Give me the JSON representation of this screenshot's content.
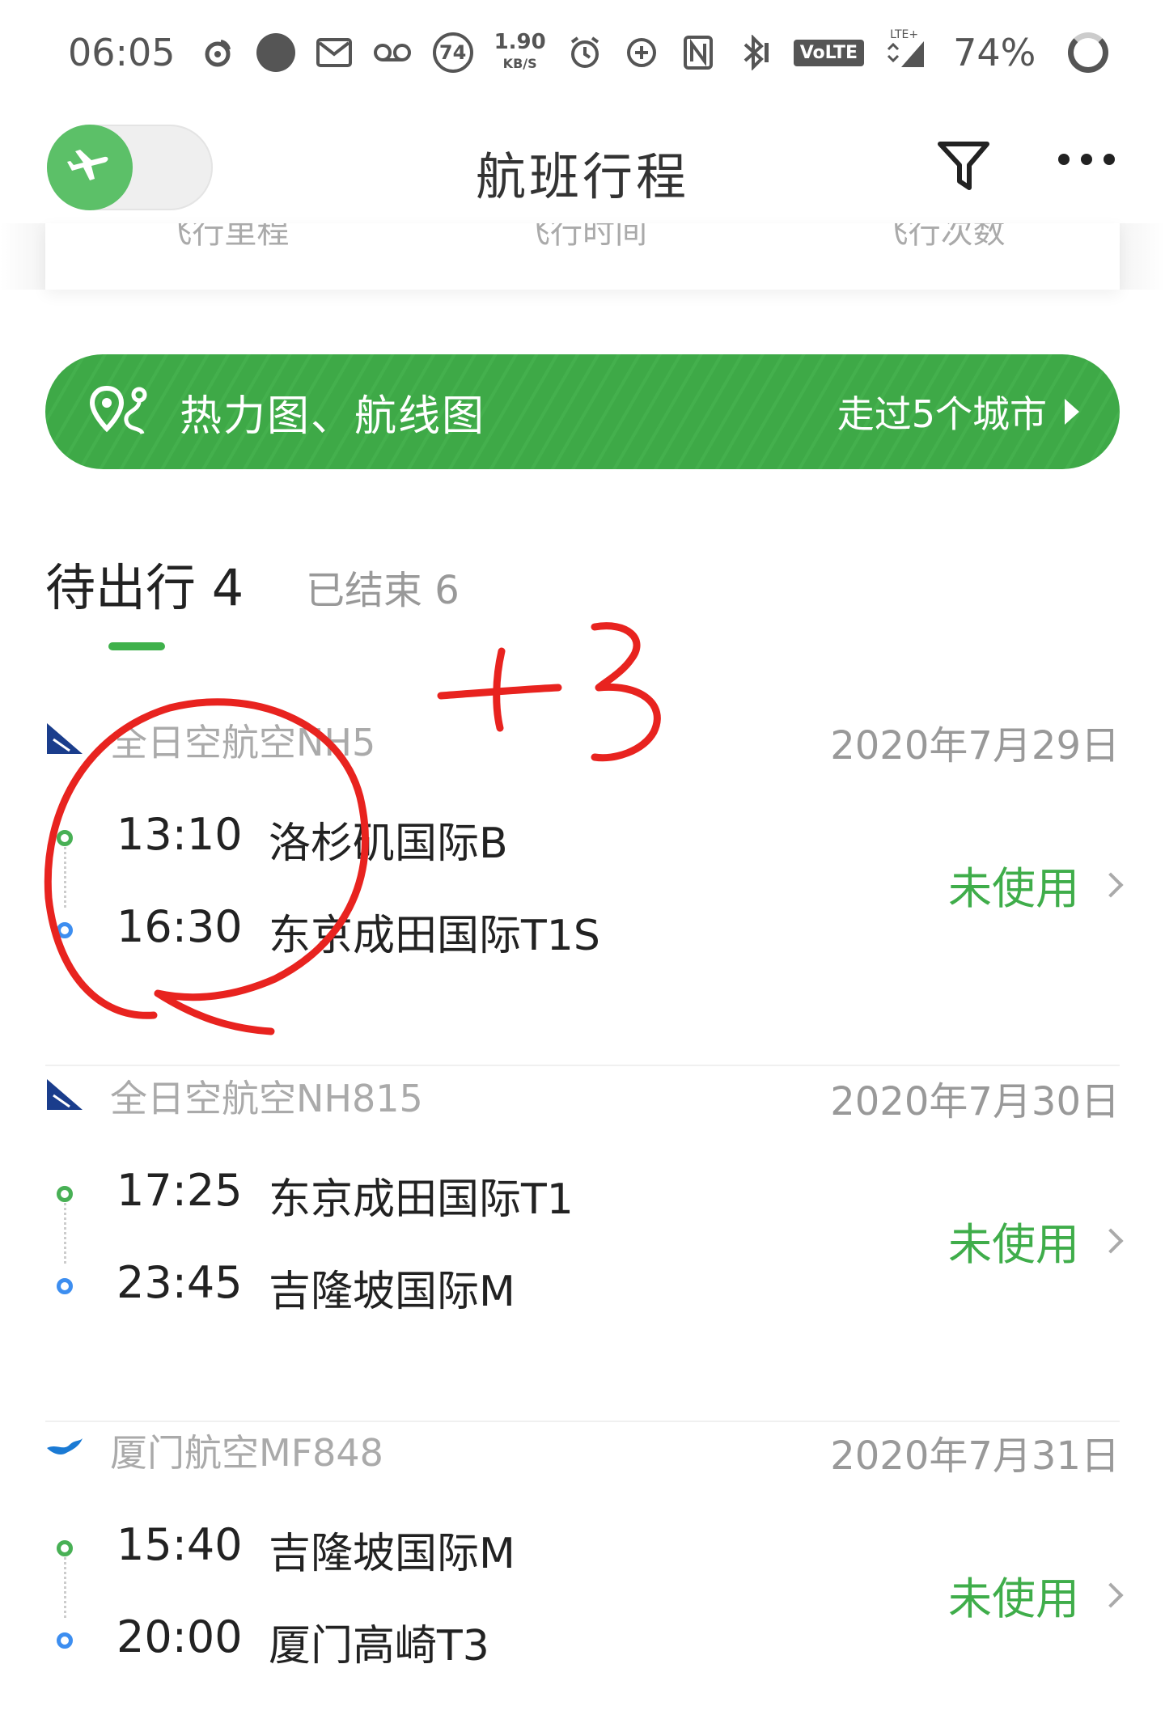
{
  "status_bar": {
    "time": "06:05",
    "net_speed_value": "1.90",
    "net_speed_unit": "KB/S",
    "notif_count": "74",
    "volte": "VoLTE",
    "lte": "LTE+",
    "battery": "74%"
  },
  "header": {
    "title": "航班行程"
  },
  "stats": {
    "labels": [
      "飞行里程",
      "飞行时间",
      "飞行次数"
    ]
  },
  "banner": {
    "label": "热力图、航线图",
    "right_text": "走过5个城市"
  },
  "tabs": {
    "upcoming": "待出行 4",
    "finished": "已结束 6"
  },
  "flights": [
    {
      "airline": "全日空航空NH5",
      "date": "2020年7月29日",
      "dep_time": "13:10",
      "dep_airport": "洛杉矶国际B",
      "arr_time": "16:30",
      "arr_airport": "东京成田国际T1S",
      "status": "未使用"
    },
    {
      "airline": "全日空航空NH815",
      "date": "2020年7月30日",
      "dep_time": "17:25",
      "dep_airport": "东京成田国际T1",
      "arr_time": "23:45",
      "arr_airport": "吉隆坡国际M",
      "status": "未使用"
    },
    {
      "airline": "厦门航空MF848",
      "date": "2020年7月31日",
      "dep_time": "15:40",
      "dep_airport": "吉隆坡国际M",
      "arr_time": "20:00",
      "arr_airport": "厦门高崎T3",
      "status": "未使用"
    }
  ],
  "annotation": {
    "text": "+3",
    "color": "#e8231f"
  },
  "colors": {
    "brand_green": "#3fb14b",
    "arrival_blue": "#3d8ef0",
    "ana_blue": "#1a3d8c"
  }
}
